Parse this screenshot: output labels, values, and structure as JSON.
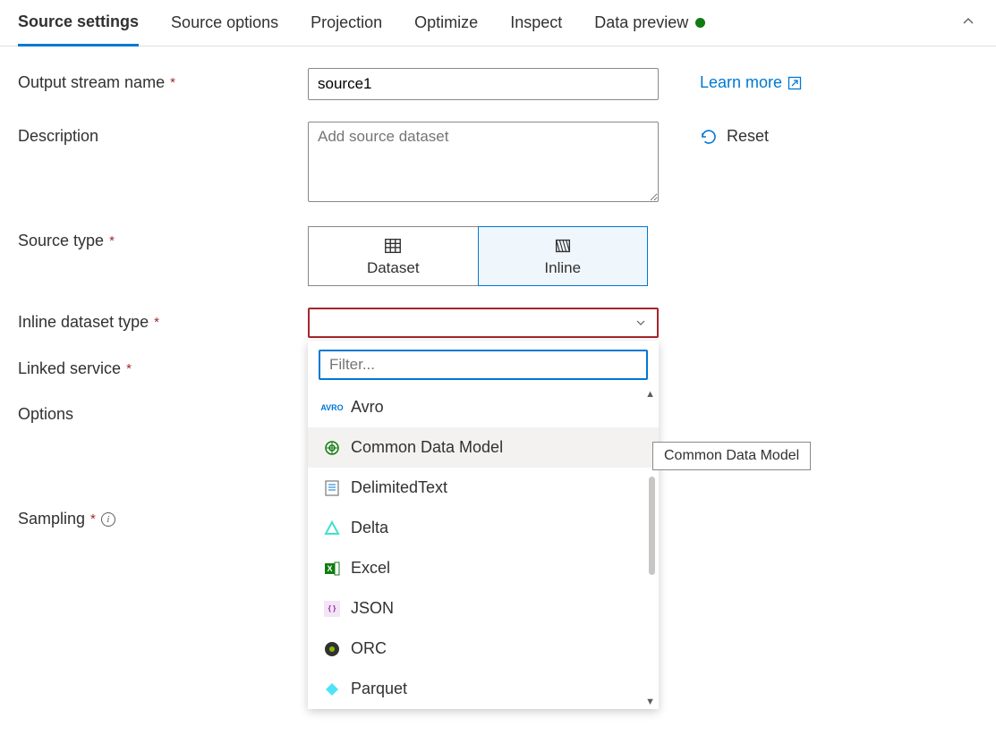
{
  "tabs": [
    {
      "label": "Source settings",
      "active": true
    },
    {
      "label": "Source options",
      "active": false
    },
    {
      "label": "Projection",
      "active": false
    },
    {
      "label": "Optimize",
      "active": false
    },
    {
      "label": "Inspect",
      "active": false
    },
    {
      "label": "Data preview",
      "active": false,
      "status": "green"
    }
  ],
  "form": {
    "output_stream_name": {
      "label": "Output stream name",
      "value": "source1",
      "required": true
    },
    "description": {
      "label": "Description",
      "placeholder": "Add source dataset",
      "value": ""
    },
    "source_type": {
      "label": "Source type",
      "required": true,
      "options": [
        {
          "label": "Dataset",
          "icon": "table-icon",
          "selected": false
        },
        {
          "label": "Inline",
          "icon": "inline-icon",
          "selected": true
        }
      ]
    },
    "inline_dataset_type": {
      "label": "Inline dataset type",
      "required": true,
      "value": ""
    },
    "linked_service": {
      "label": "Linked service",
      "required": true
    },
    "options": {
      "label": "Options"
    },
    "sampling": {
      "label": "Sampling",
      "required": true
    }
  },
  "side": {
    "learn_more": "Learn more",
    "reset": "Reset"
  },
  "dropdown": {
    "filter_placeholder": "Filter...",
    "items": [
      {
        "label": "Avro",
        "icon": "avro-icon",
        "hover": false
      },
      {
        "label": "Common Data Model",
        "icon": "cdm-icon",
        "hover": true
      },
      {
        "label": "DelimitedText",
        "icon": "csv-icon",
        "hover": false
      },
      {
        "label": "Delta",
        "icon": "delta-icon",
        "hover": false
      },
      {
        "label": "Excel",
        "icon": "excel-icon",
        "hover": false
      },
      {
        "label": "JSON",
        "icon": "json-icon",
        "hover": false
      },
      {
        "label": "ORC",
        "icon": "orc-icon",
        "hover": false
      },
      {
        "label": "Parquet",
        "icon": "parquet-icon",
        "hover": false
      }
    ],
    "tooltip": "Common Data Model"
  }
}
